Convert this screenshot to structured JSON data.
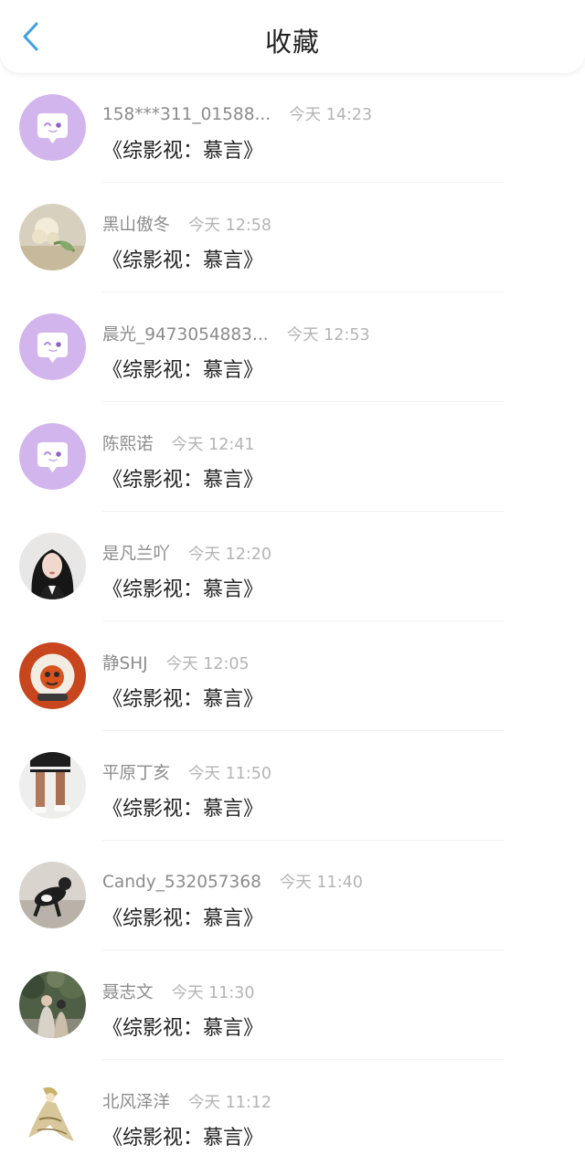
{
  "header": {
    "title": "收藏",
    "accent_color": "#3da0e8"
  },
  "items": [
    {
      "name": "158***311_01588...",
      "time": "今天 14:23",
      "content": "《综影视：慕言》",
      "avatar": "default-chat-avatar"
    },
    {
      "name": "黑山傲冬",
      "time": "今天 12:58",
      "content": "《综影视：慕言》",
      "avatar": "flower-photo-avatar"
    },
    {
      "name": "晨光_9473054883...",
      "time": "今天 12:53",
      "content": "《综影视：慕言》",
      "avatar": "default-chat-avatar"
    },
    {
      "name": "陈熙诺",
      "time": "今天 12:41",
      "content": "《综影视：慕言》",
      "avatar": "default-chat-avatar"
    },
    {
      "name": "是凡兰吖",
      "time": "今天 12:20",
      "content": "《综影视：慕言》",
      "avatar": "girl-portrait-avatar"
    },
    {
      "name": "静SHJ",
      "time": "今天 12:05",
      "content": "《综影视：慕言》",
      "avatar": "orange-cartoon-avatar"
    },
    {
      "name": "平原丁亥",
      "time": "今天 11:50",
      "content": "《综影视：慕言》",
      "avatar": "legs-photo-avatar"
    },
    {
      "name": "Candy_532057368",
      "time": "今天 11:40",
      "content": "《综影视：慕言》",
      "avatar": "dog-photo-avatar"
    },
    {
      "name": "聂志文",
      "time": "今天 11:30",
      "content": "《综影视：慕言》",
      "avatar": "forest-photo-avatar"
    },
    {
      "name": "北风泽洋",
      "time": "今天 11:12",
      "content": "《综影视：慕言》",
      "avatar": "anime-character-avatar"
    }
  ]
}
